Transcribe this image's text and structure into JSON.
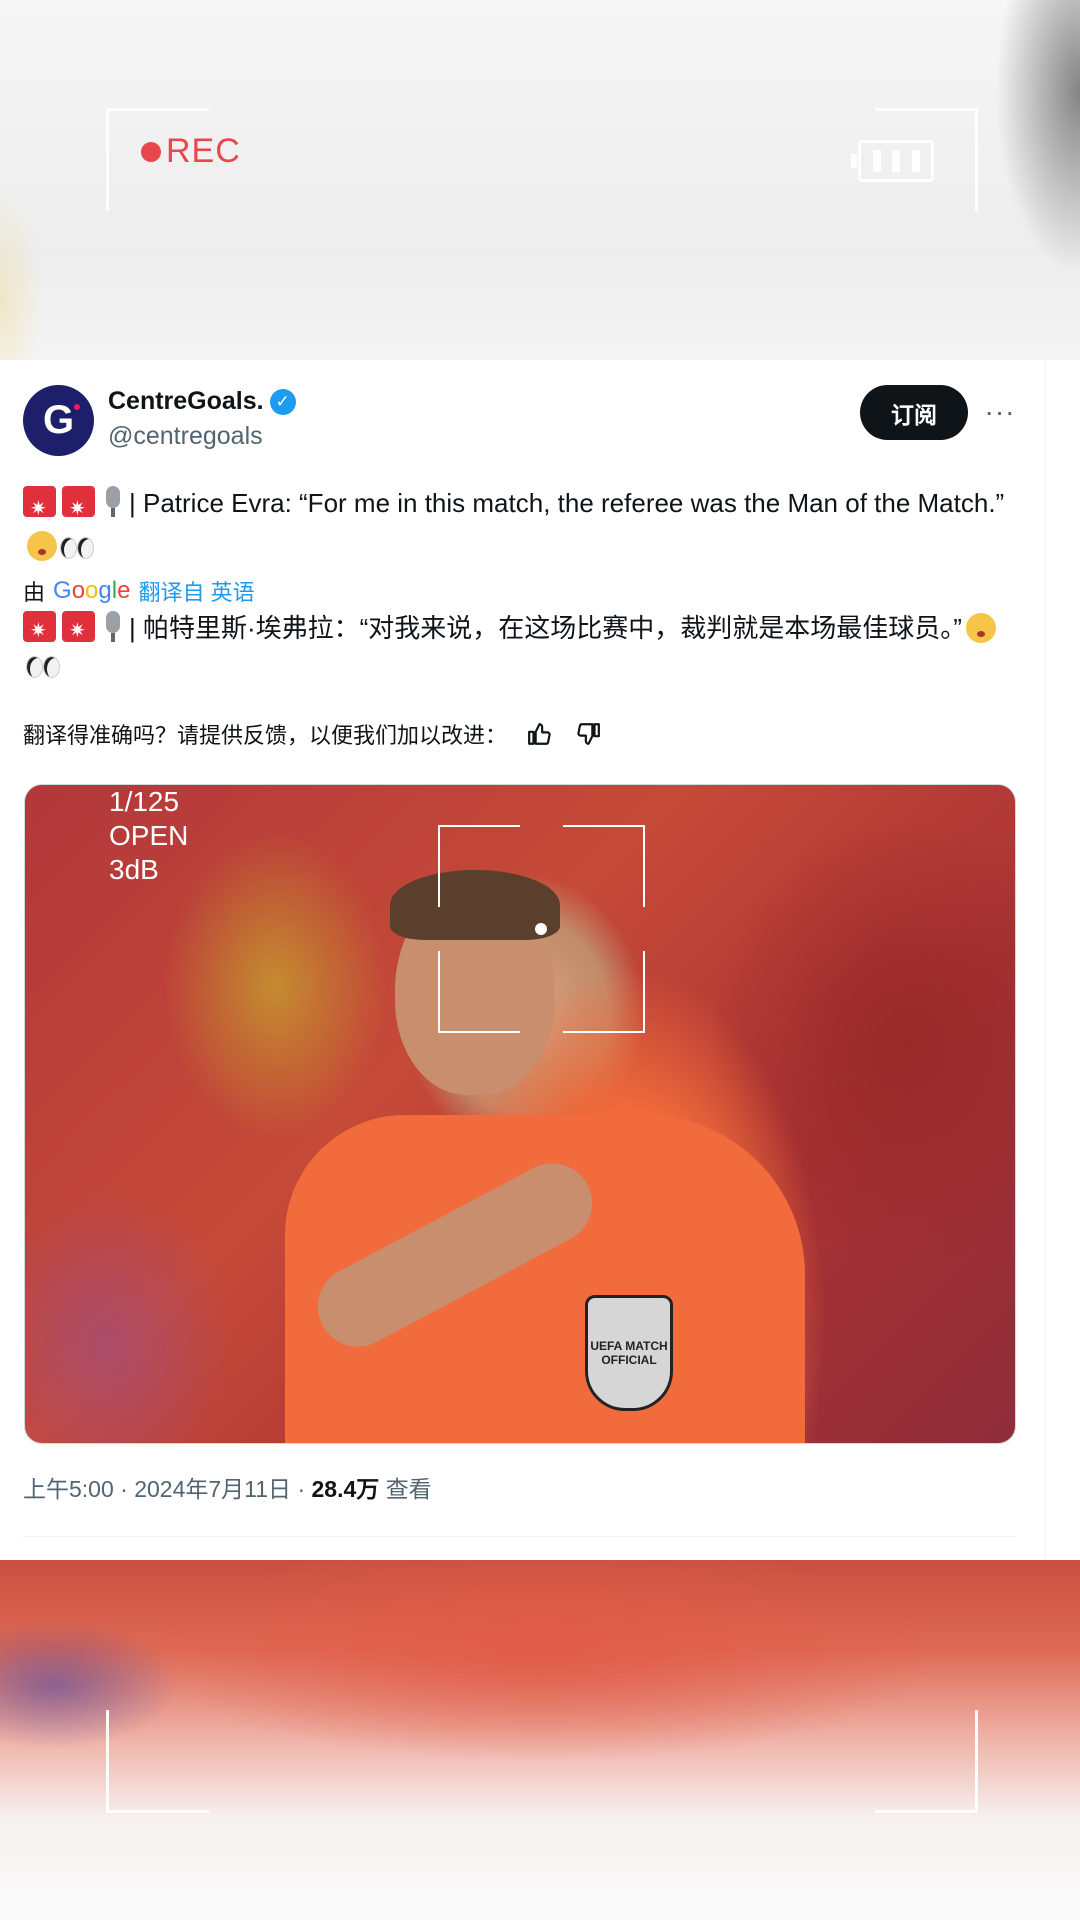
{
  "overlay": {
    "rec_label": "REC",
    "camera_info": [
      "1/125",
      "OPEN",
      "3dB"
    ]
  },
  "tweet": {
    "author_name": "CentreGoals.",
    "author_handle": "@centregoals",
    "avatar_letter": "G",
    "subscribe_label": "订阅",
    "more_label": "···",
    "original_text": "| Patrice Evra: “For me in this match, the referee was the Man of the Match.”",
    "translated_by_prefix": "由",
    "translate_link": "翻译自 英语",
    "translated_text": "| 帕特里斯·埃弗拉：“对我来说，在这场比赛中，裁判就是本场最佳球员。”",
    "feedback_prompt": "翻译得准确吗？请提供反馈，以便我们加以改进：",
    "media_badge_text": "UEFA MATCH OFFICIAL",
    "time": "上午5:00",
    "date": "2024年7月11日",
    "views_count": "28.4万",
    "views_label": "查看"
  },
  "colors": {
    "accent": "#1d9bf0",
    "rec": "#e8474e",
    "text_primary": "#0f1419",
    "text_secondary": "#536471"
  }
}
